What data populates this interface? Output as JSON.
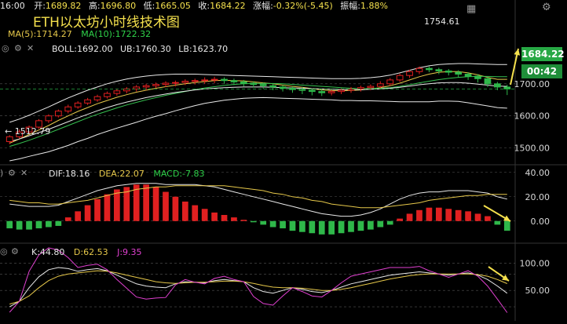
{
  "header": {
    "time": "16:00",
    "open_label": "开:",
    "open": "1689.82",
    "high_label": "高:",
    "high": "1696.80",
    "low_label": "低:",
    "low": "1665.05",
    "close_label": "收:",
    "close": "1684.22",
    "change_label": "涨幅:",
    "change": "-0.32%(-5.45)",
    "amp_label": "振幅:",
    "amp": "1.88%"
  },
  "title": "ETH以太坊小时线技术图",
  "ma_legend": {
    "ma5": "MA(5):1714.27",
    "ma10": "MA(10):1722.32"
  },
  "boll_legend": {
    "boll": "BOLL:1692.00",
    "ub": "UB:1760.30",
    "lb": "LB:1623.70"
  },
  "macd_legend": {
    "dif": "DIF:18.16",
    "dea": "DEA:22.07",
    "macd": "MACD:-7.83"
  },
  "kdj_legend": {
    "k": "K:44.80",
    "d": "D:62.53",
    "j": "J:9.35"
  },
  "price_box": "1684.22",
  "time_box": "00:42",
  "colors": {
    "up": "#e02020",
    "down": "#2fb84a",
    "accent": "#f4e04d",
    "pink": "#e040d0"
  },
  "chart_data": [
    {
      "type": "candlestick",
      "annotations": {
        "max": "1754.61",
        "min": "← 1512.79"
      },
      "ylim": [
        1460,
        1790
      ],
      "yticks": [
        1500,
        1600,
        1700
      ],
      "ytick_labels": [
        "1500.00",
        "1600.00",
        "1700.00"
      ],
      "candles": [
        [
          1520,
          1535,
          1512,
          1540
        ],
        [
          1535,
          1550,
          1530,
          1558
        ],
        [
          1550,
          1565,
          1545,
          1570
        ],
        [
          1565,
          1585,
          1560,
          1590
        ],
        [
          1585,
          1600,
          1578,
          1605
        ],
        [
          1600,
          1615,
          1595,
          1620
        ],
        [
          1615,
          1628,
          1608,
          1635
        ],
        [
          1628,
          1640,
          1622,
          1646
        ],
        [
          1640,
          1650,
          1634,
          1656
        ],
        [
          1650,
          1660,
          1644,
          1666
        ],
        [
          1660,
          1670,
          1654,
          1676
        ],
        [
          1670,
          1678,
          1663,
          1684
        ],
        [
          1678,
          1684,
          1670,
          1690
        ],
        [
          1684,
          1690,
          1676,
          1696
        ],
        [
          1690,
          1694,
          1680,
          1700
        ],
        [
          1694,
          1698,
          1686,
          1704
        ],
        [
          1698,
          1702,
          1690,
          1708
        ],
        [
          1702,
          1704,
          1692,
          1710
        ],
        [
          1704,
          1708,
          1696,
          1714
        ],
        [
          1708,
          1710,
          1698,
          1716
        ],
        [
          1710,
          1712,
          1700,
          1720
        ],
        [
          1712,
          1714,
          1702,
          1722
        ],
        [
          1714,
          1710,
          1700,
          1720
        ],
        [
          1710,
          1706,
          1696,
          1716
        ],
        [
          1706,
          1702,
          1692,
          1712
        ],
        [
          1702,
          1698,
          1688,
          1708
        ],
        [
          1698,
          1694,
          1684,
          1704
        ],
        [
          1694,
          1690,
          1680,
          1700
        ],
        [
          1690,
          1686,
          1676,
          1696
        ],
        [
          1686,
          1682,
          1672,
          1692
        ],
        [
          1682,
          1680,
          1668,
          1690
        ],
        [
          1680,
          1676,
          1664,
          1686
        ],
        [
          1676,
          1672,
          1662,
          1682
        ],
        [
          1672,
          1676,
          1664,
          1682
        ],
        [
          1676,
          1680,
          1668,
          1686
        ],
        [
          1680,
          1684,
          1672,
          1690
        ],
        [
          1684,
          1688,
          1676,
          1694
        ],
        [
          1688,
          1692,
          1680,
          1698
        ],
        [
          1692,
          1700,
          1686,
          1708
        ],
        [
          1700,
          1712,
          1694,
          1718
        ],
        [
          1712,
          1726,
          1706,
          1732
        ],
        [
          1726,
          1738,
          1718,
          1744
        ],
        [
          1738,
          1748,
          1730,
          1754
        ],
        [
          1748,
          1744,
          1736,
          1754
        ],
        [
          1744,
          1740,
          1730,
          1750
        ],
        [
          1740,
          1736,
          1726,
          1746
        ],
        [
          1736,
          1730,
          1720,
          1742
        ],
        [
          1730,
          1724,
          1712,
          1736
        ],
        [
          1724,
          1716,
          1704,
          1730
        ],
        [
          1716,
          1700,
          1690,
          1722
        ],
        [
          1700,
          1690,
          1680,
          1706
        ],
        [
          1690,
          1684,
          1665,
          1697
        ]
      ],
      "series": [
        {
          "name": "MA(5)",
          "color": "#e6c84a",
          "values": [
            1515,
            1528,
            1542,
            1556,
            1570,
            1586,
            1600,
            1614,
            1626,
            1638,
            1648,
            1658,
            1666,
            1674,
            1680,
            1686,
            1691,
            1696,
            1700,
            1704,
            1707,
            1710,
            1711,
            1710,
            1709,
            1706,
            1703,
            1700,
            1696,
            1692,
            1689,
            1685,
            1681,
            1679,
            1678,
            1679,
            1681,
            1684,
            1688,
            1694,
            1702,
            1712,
            1722,
            1730,
            1736,
            1738,
            1738,
            1734,
            1728,
            1720,
            1714,
            1714
          ]
        },
        {
          "name": "MA(10)",
          "color": "#36c050",
          "values": [
            1505,
            1514,
            1524,
            1535,
            1546,
            1558,
            1570,
            1582,
            1594,
            1605,
            1615,
            1625,
            1634,
            1642,
            1650,
            1657,
            1664,
            1670,
            1676,
            1682,
            1687,
            1691,
            1695,
            1698,
            1700,
            1701,
            1701,
            1701,
            1700,
            1698,
            1696,
            1694,
            1692,
            1690,
            1688,
            1686,
            1685,
            1685,
            1686,
            1688,
            1692,
            1697,
            1703,
            1708,
            1713,
            1717,
            1720,
            1722,
            1723,
            1723,
            1722,
            1722
          ]
        },
        {
          "name": "UB",
          "color": "#e8e8e8",
          "values": [
            1580,
            1590,
            1602,
            1615,
            1628,
            1642,
            1656,
            1668,
            1680,
            1690,
            1700,
            1708,
            1715,
            1720,
            1724,
            1727,
            1729,
            1730,
            1730,
            1730,
            1729,
            1728,
            1727,
            1726,
            1725,
            1724,
            1723,
            1722,
            1721,
            1720,
            1719,
            1718,
            1717,
            1716,
            1716,
            1716,
            1717,
            1719,
            1722,
            1727,
            1734,
            1742,
            1750,
            1756,
            1760,
            1762,
            1763,
            1763,
            1762,
            1761,
            1760,
            1760
          ]
        },
        {
          "name": "BOLL",
          "color": "#e8e8e8",
          "values": [
            1520,
            1528,
            1538,
            1548,
            1558,
            1570,
            1582,
            1594,
            1605,
            1616,
            1626,
            1635,
            1643,
            1650,
            1657,
            1663,
            1668,
            1673,
            1677,
            1681,
            1684,
            1686,
            1688,
            1689,
            1690,
            1690,
            1690,
            1689,
            1688,
            1687,
            1686,
            1685,
            1684,
            1683,
            1682,
            1682,
            1682,
            1683,
            1684,
            1686,
            1689,
            1693,
            1697,
            1700,
            1703,
            1704,
            1704,
            1702,
            1699,
            1696,
            1693,
            1692
          ]
        },
        {
          "name": "LB",
          "color": "#e8e8e8",
          "values": [
            1460,
            1466,
            1474,
            1481,
            1488,
            1498,
            1508,
            1520,
            1530,
            1542,
            1552,
            1562,
            1571,
            1580,
            1590,
            1599,
            1607,
            1616,
            1624,
            1632,
            1639,
            1644,
            1649,
            1652,
            1655,
            1656,
            1657,
            1656,
            1655,
            1654,
            1653,
            1652,
            1651,
            1650,
            1648,
            1648,
            1647,
            1647,
            1646,
            1645,
            1644,
            1644,
            1644,
            1644,
            1646,
            1646,
            1645,
            1641,
            1636,
            1631,
            1626,
            1624
          ]
        }
      ]
    },
    {
      "type": "bar+line",
      "ylim": [
        -15,
        45
      ],
      "yticks": [
        0,
        20,
        40
      ],
      "ytick_labels": [
        "0.00",
        "20.00",
        "40.00"
      ],
      "macd": [
        -6,
        -7,
        -7,
        -6,
        -5,
        -4,
        3,
        8,
        13,
        18,
        22,
        26,
        28,
        30,
        30,
        28,
        24,
        20,
        16,
        13,
        10,
        7,
        5,
        3,
        1,
        -1,
        -3,
        -5,
        -6,
        -8,
        -9,
        -10,
        -11,
        -11,
        -10,
        -9,
        -8,
        -7,
        -5,
        -3,
        2,
        6,
        9,
        11,
        11,
        10,
        9,
        8,
        6,
        4,
        -3,
        -8
      ],
      "series": [
        {
          "name": "DIF",
          "color": "#e8e8e8",
          "values": [
            14,
            13,
            12,
            12,
            12,
            13,
            16,
            19,
            22,
            25,
            27,
            29,
            30,
            31,
            31,
            31,
            30,
            30,
            30,
            30,
            29,
            28,
            26,
            24,
            22,
            20,
            18,
            16,
            14,
            12,
            10,
            8,
            6,
            5,
            4,
            4,
            5,
            7,
            10,
            14,
            18,
            21,
            23,
            24,
            24,
            25,
            25,
            25,
            24,
            23,
            20,
            18
          ]
        },
        {
          "name": "DEA",
          "color": "#e6c84a",
          "values": [
            17,
            16,
            15,
            15,
            14,
            14,
            15,
            16,
            17,
            19,
            21,
            23,
            24,
            26,
            27,
            28,
            28,
            29,
            29,
            29,
            29,
            29,
            29,
            28,
            27,
            26,
            25,
            23,
            22,
            20,
            19,
            17,
            16,
            14,
            13,
            12,
            11,
            11,
            11,
            12,
            13,
            14,
            15,
            17,
            18,
            19,
            20,
            21,
            21,
            22,
            22,
            22
          ]
        }
      ]
    },
    {
      "type": "line",
      "ylim": [
        0,
        125
      ],
      "yticks": [
        50,
        100
      ],
      "ytick_labels": [
        "50.00",
        "100.00"
      ],
      "series": [
        {
          "name": "K",
          "color": "#e8e8e8",
          "values": [
            20,
            30,
            55,
            75,
            88,
            92,
            90,
            85,
            88,
            90,
            86,
            78,
            70,
            62,
            58,
            56,
            55,
            62,
            66,
            65,
            64,
            68,
            70,
            68,
            66,
            55,
            48,
            45,
            50,
            55,
            52,
            48,
            46,
            50,
            56,
            62,
            66,
            70,
            74,
            78,
            80,
            82,
            84,
            82,
            80,
            78,
            80,
            82,
            78,
            70,
            58,
            44.8
          ]
        },
        {
          "name": "D",
          "color": "#e6c84a",
          "values": [
            25,
            30,
            40,
            55,
            68,
            76,
            80,
            82,
            84,
            86,
            85,
            82,
            78,
            74,
            70,
            66,
            64,
            63,
            64,
            65,
            65,
            66,
            67,
            67,
            66,
            63,
            59,
            56,
            55,
            55,
            54,
            52,
            50,
            50,
            52,
            55,
            59,
            63,
            67,
            71,
            74,
            77,
            79,
            80,
            80,
            80,
            80,
            80,
            79,
            76,
            70,
            62.53
          ]
        },
        {
          "name": "J",
          "color": "#e040d0",
          "values": [
            10,
            30,
            85,
            115,
            128,
            124,
            110,
            92,
            96,
            98,
            88,
            70,
            54,
            38,
            34,
            36,
            37,
            60,
            70,
            65,
            62,
            72,
            76,
            70,
            66,
            39,
            26,
            23,
            40,
            55,
            48,
            40,
            38,
            50,
            64,
            76,
            80,
            84,
            88,
            92,
            92,
            92,
            94,
            86,
            80,
            74,
            80,
            86,
            76,
            58,
            34,
            9.35
          ]
        }
      ]
    }
  ]
}
